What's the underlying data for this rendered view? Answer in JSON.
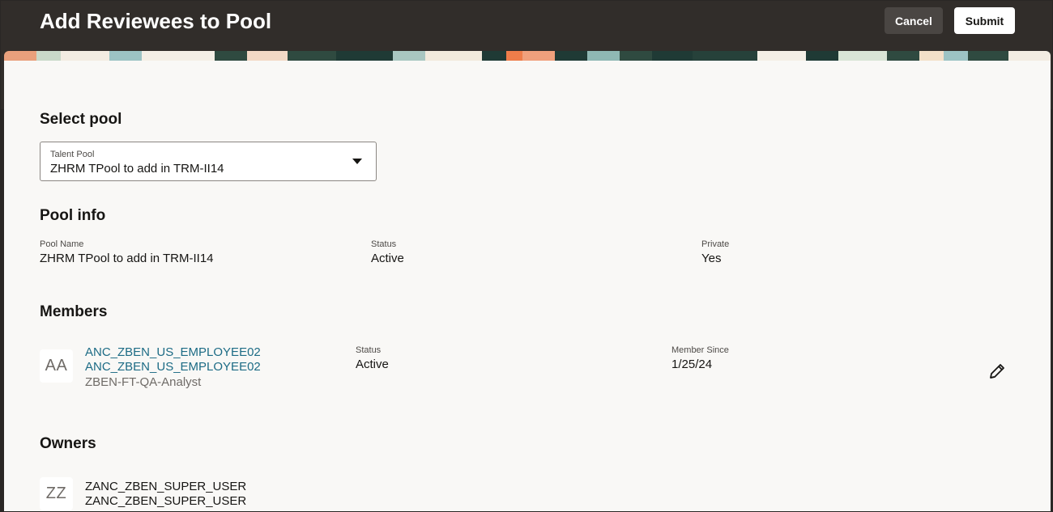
{
  "header": {
    "title": "Add Reviewees to Pool",
    "cancel_label": "Cancel",
    "submit_label": "Submit"
  },
  "select_pool": {
    "heading": "Select pool",
    "field_label": "Talent Pool",
    "value": "ZHRM TPool to add in TRM-II14",
    "icon": "caret-down-icon"
  },
  "pool_info": {
    "heading": "Pool info",
    "fields": [
      {
        "label": "Pool Name",
        "value": "ZHRM TPool to add in TRM-II14"
      },
      {
        "label": "Status",
        "value": "Active"
      },
      {
        "label": "Private",
        "value": "Yes"
      }
    ]
  },
  "members": {
    "heading": "Members",
    "items": [
      {
        "initials": "AA",
        "name_line1": "ANC_ZBEN_US_EMPLOYEE02",
        "name_line2": "ANC_ZBEN_US_EMPLOYEE02",
        "job": "ZBEN-FT-QA-Analyst",
        "status_label": "Status",
        "status_value": "Active",
        "since_label": "Member Since",
        "since_value": "1/25/24",
        "action_icon": "pencil-edit-icon"
      }
    ]
  },
  "owners": {
    "heading": "Owners",
    "items": [
      {
        "initials": "ZZ",
        "name_line1": "ZANC_ZBEN_SUPER_USER",
        "name_line2": "ZANC_ZBEN_SUPER_USER"
      }
    ]
  },
  "colors": {
    "header_bg": "#312d2a",
    "page_bg": "#f9f8f6",
    "link": "#1c6b85",
    "cancel_bg": "#4a4643"
  }
}
